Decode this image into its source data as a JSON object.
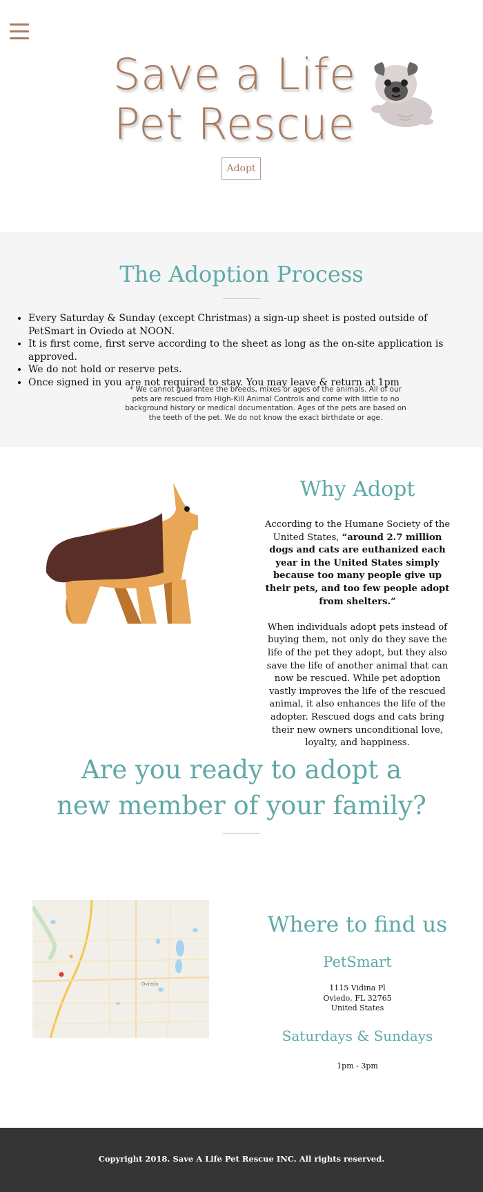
{
  "header": {
    "title_line1": "Save a Life",
    "title_line2": "Pet Rescue",
    "adopt_button": "Adopt",
    "menu_icon": "hamburger-icon",
    "mascot_icon": "pug-icon"
  },
  "process": {
    "title": "The Adoption Process",
    "items": [
      "Every Saturday & Sunday (except Christmas) a sign-up sheet is posted outside of PetSmart in Oviedo at NOON.",
      "It is first come, first serve according to the sheet as long as the on-site application is approved.",
      "We do not hold or reserve pets.",
      "Once signed in you are not required to stay. You may leave & return at 1pm"
    ],
    "disclaimer": "* We cannot guarantee the breeds, mixes or ages of the animals. All of our pets are rescued from High-Kill Animal Controls and come with little to no background history or medical documentation. Ages of the pets are based on the teeth of the pet. We do not know the exact birthdate or age."
  },
  "why": {
    "title": "Why Adopt",
    "intro": "According to the Humane Society of the United States, ",
    "quote": "“around 2.7 million dogs and cats are euthanized each year in the United States simply because too many people give up their pets, and too few people adopt from shelters.”",
    "paragraph": "When individuals adopt pets instead of buying them, not only do they save the life of the pet they adopt, but they also save the life of another animal that can now be rescued. While pet adoption vastly improves the life of the rescued animal, it also enhances the life of the adopter. Rescued dogs and cats bring their new owners unconditional love, loyalty, and happiness.",
    "image_icon": "german-shepherd-icon"
  },
  "ready": {
    "line1": "Are you ready to adopt a",
    "line2": "new member of your family?"
  },
  "location": {
    "title": "Where to find us",
    "store": "PetSmart",
    "address_line1": "1115 Vidina Pl",
    "address_line2": "Oviedo, FL 32765",
    "address_line3": "United States",
    "days": "Saturdays & Sundays",
    "hours": "1pm - 3pm",
    "map_label": "Oviedo"
  },
  "footer": {
    "copyright": "Copyright 2018. Save A Life Pet Rescue INC. All rights reserved."
  },
  "colors": {
    "brand_brown": "#a97a5d",
    "teal": "#5fa9a7",
    "footer_bg": "#353535",
    "section_gray": "#f5f5f5"
  }
}
